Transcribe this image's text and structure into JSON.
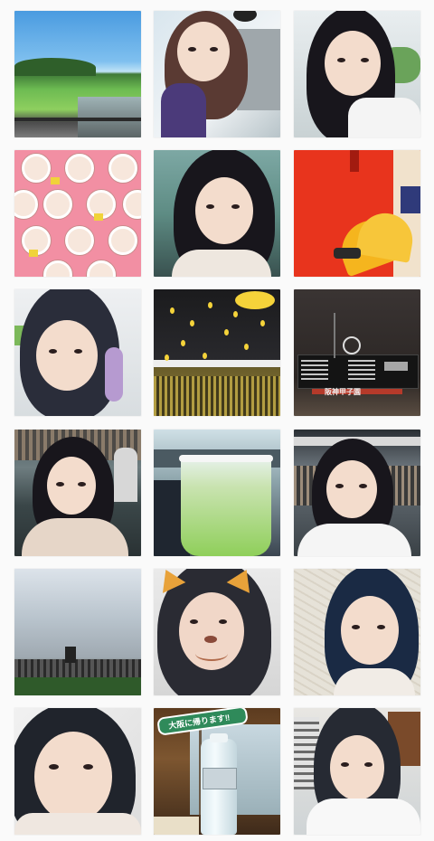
{
  "feed": {
    "tiles": [
      {
        "name": "tile-1",
        "subject": "scenic-landscape"
      },
      {
        "name": "tile-2",
        "subject": "cat-filter-selfie"
      },
      {
        "name": "tile-3",
        "subject": "selfie"
      },
      {
        "name": "tile-4",
        "subject": "pink-cartoon-pattern"
      },
      {
        "name": "tile-5",
        "subject": "selfie"
      },
      {
        "name": "tile-6",
        "subject": "yellow-fans-on-red-seats"
      },
      {
        "name": "tile-7",
        "subject": "selfie"
      },
      {
        "name": "tile-8",
        "subject": "stadium-balloons"
      },
      {
        "name": "tile-9",
        "subject": "stadium-scoreboard-night"
      },
      {
        "name": "tile-10",
        "subject": "stadium-selfie"
      },
      {
        "name": "tile-11",
        "subject": "green-drink-cup"
      },
      {
        "name": "tile-12",
        "subject": "stadium-selfie"
      },
      {
        "name": "tile-13",
        "subject": "stadium-sky"
      },
      {
        "name": "tile-14",
        "subject": "cat-filter-selfie"
      },
      {
        "name": "tile-15",
        "subject": "selfie-map-wall"
      },
      {
        "name": "tile-16",
        "subject": "selfie-closeup"
      },
      {
        "name": "tile-17",
        "subject": "water-bottle-banner"
      },
      {
        "name": "tile-18",
        "subject": "selfie-office"
      }
    ],
    "banner_text": "大阪に帰ります‼",
    "scoreboard_text": "阪神甲子園",
    "colors": {
      "background": "#fafafa",
      "pink_pattern": "#f28fa3",
      "red_seats": "#e8341d",
      "yellow_fan": "#f5b51e"
    }
  }
}
